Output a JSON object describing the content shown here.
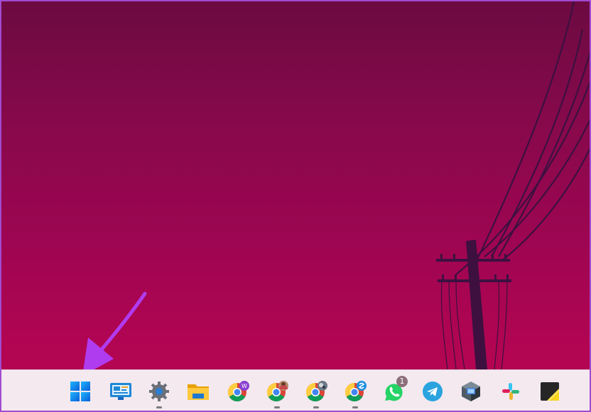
{
  "desktop": {
    "wallpaper": "utility-pole-silhouette-at-dusk",
    "colors": {
      "top": "#6c0a42",
      "bottom": "#b50552",
      "silhouette": "#3d1040",
      "frame": "#a14bd0"
    }
  },
  "annotation": {
    "type": "arrow",
    "color": "#b03cf0",
    "points_to": "start-button"
  },
  "taskbar": {
    "background": "#f3e9ef",
    "items": [
      {
        "name": "start",
        "icon": "windows-logo-icon",
        "running": false
      },
      {
        "name": "widgets-app",
        "icon": "widgets-icon",
        "running": false
      },
      {
        "name": "settings",
        "icon": "gear-icon",
        "running": true
      },
      {
        "name": "file-explorer",
        "icon": "folder-icon",
        "running": false
      },
      {
        "name": "chrome-profile-w",
        "icon": "chrome-icon",
        "running": false,
        "profile_letter": "W"
      },
      {
        "name": "chrome-profile-photo-1",
        "icon": "chrome-icon",
        "running": true
      },
      {
        "name": "chrome-profile-photo-2",
        "icon": "chrome-icon",
        "running": true
      },
      {
        "name": "chrome-profile-logo",
        "icon": "chrome-icon",
        "running": true
      },
      {
        "name": "whatsapp",
        "icon": "whatsapp-icon",
        "running": false,
        "badge": "1"
      },
      {
        "name": "telegram",
        "icon": "telegram-icon",
        "running": false
      },
      {
        "name": "virtualbox",
        "icon": "virtualbox-icon",
        "running": false
      },
      {
        "name": "slack",
        "icon": "slack-icon",
        "running": false
      },
      {
        "name": "sticky-notes",
        "icon": "sticky-notes-icon",
        "running": false
      }
    ]
  }
}
